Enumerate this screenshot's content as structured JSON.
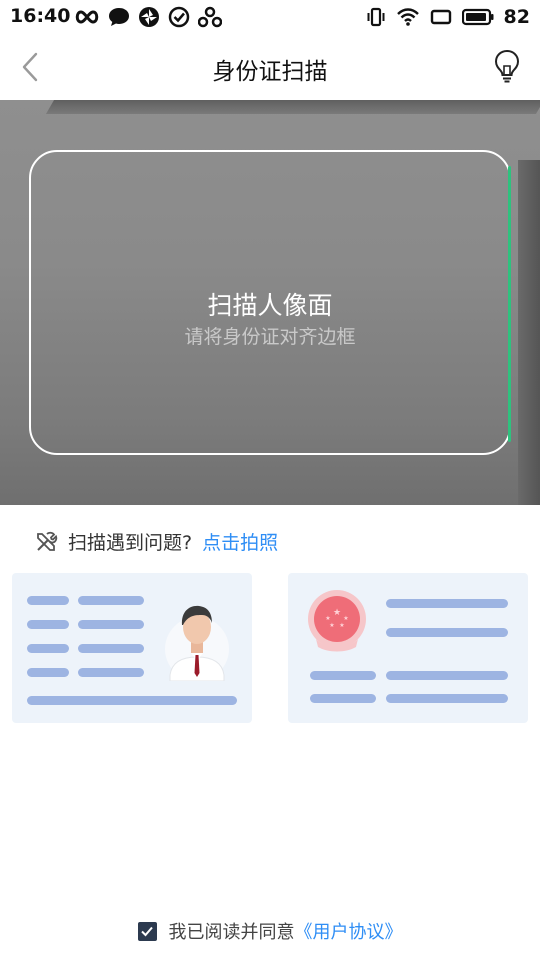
{
  "status_bar": {
    "time": "16:40",
    "battery": "82",
    "left_icons": [
      "infinity-icon",
      "chat-bubble-icon",
      "aperture-icon",
      "check-circle-icon",
      "link-nodes-icon"
    ],
    "right_icons": [
      "vibrate-icon",
      "wifi-icon",
      "screen-icon",
      "battery-icon"
    ]
  },
  "header": {
    "title": "身份证扫描",
    "back_icon": "chevron-left-icon",
    "action_icon": "lightbulb-icon"
  },
  "scanner": {
    "title": "扫描人像面",
    "hint": "请将身份证对齐边框",
    "accent_color": "#2ec27e"
  },
  "problem": {
    "text": "扫描遇到问题?",
    "link": "点击拍照",
    "icon": "tools-icon",
    "link_color": "#2f8ef5"
  },
  "cards": {
    "front": "portrait-card-illustration",
    "back": "emblem-card-illustration"
  },
  "agreement": {
    "checked": true,
    "text": "我已阅读并同意",
    "link": "《用户协议》"
  }
}
